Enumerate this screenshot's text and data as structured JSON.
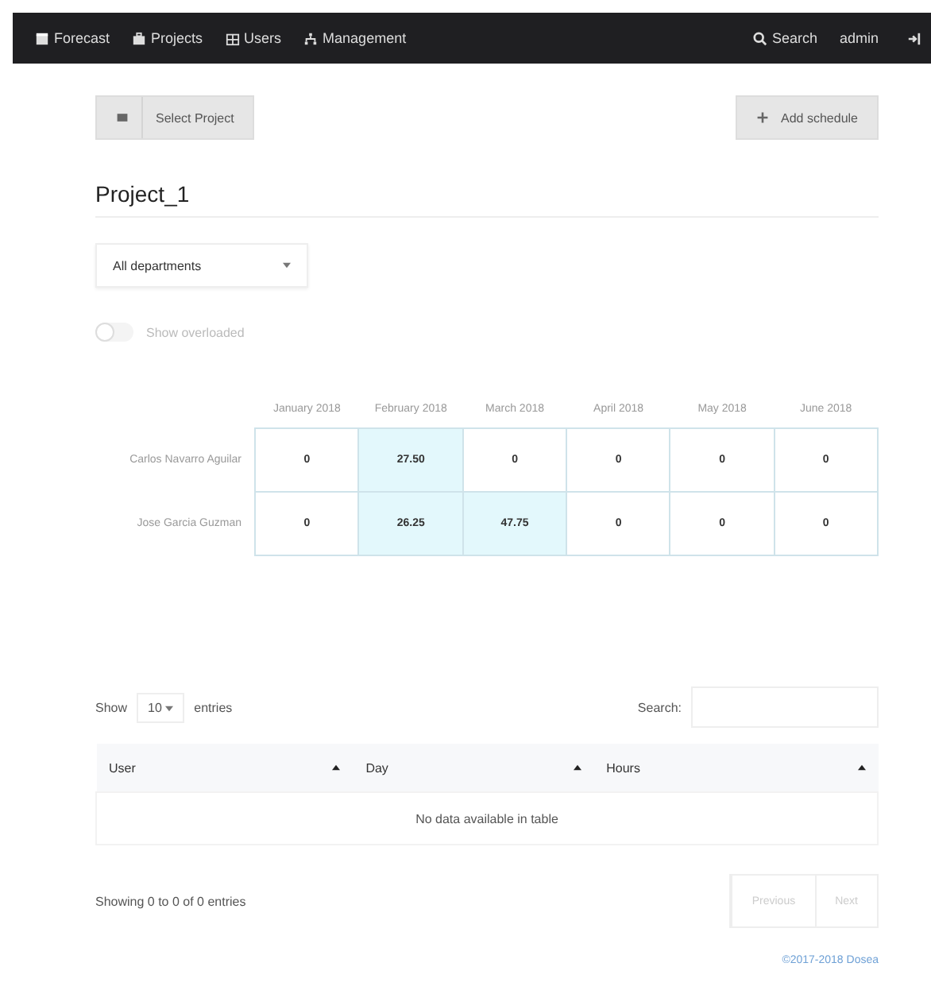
{
  "navbar": {
    "left": [
      {
        "label": "Forecast"
      },
      {
        "label": "Projects"
      },
      {
        "label": "Users"
      },
      {
        "label": "Management"
      }
    ],
    "search": "Search",
    "user": "admin"
  },
  "select_project": "Select Project",
  "add_schedule": "Add schedule",
  "project_title": "Project_1",
  "department": "All departments",
  "overloaded_toggle": {
    "label": "Show overloaded",
    "on": false
  },
  "grid": {
    "columns": [
      "January 2018",
      "February 2018",
      "March 2018",
      "April 2018",
      "May 2018",
      "June 2018"
    ],
    "rows": [
      {
        "name": "Carlos Navarro Aguilar",
        "cells": [
          {
            "value": "0",
            "highlight": false
          },
          {
            "value": "27.50",
            "highlight": true
          },
          {
            "value": "0",
            "highlight": false
          },
          {
            "value": "0",
            "highlight": false
          },
          {
            "value": "0",
            "highlight": false
          },
          {
            "value": "0",
            "highlight": false
          }
        ]
      },
      {
        "name": "Jose Garcia Guzman",
        "cells": [
          {
            "value": "0",
            "highlight": false
          },
          {
            "value": "26.25",
            "highlight": true
          },
          {
            "value": "47.75",
            "highlight": true
          },
          {
            "value": "0",
            "highlight": false
          },
          {
            "value": "0",
            "highlight": false
          },
          {
            "value": "0",
            "highlight": false
          }
        ]
      }
    ]
  },
  "entries": {
    "show": "Show",
    "count": "10",
    "suffix": "entries",
    "search_label": "Search:"
  },
  "table": {
    "columns": [
      "User",
      "Day",
      "Hours"
    ],
    "empty": "No data available in table"
  },
  "info": "Showing 0 to 0 of 0 entries",
  "pagination": [
    {
      "label": "Previous",
      "disabled": true
    },
    {
      "label": "Next",
      "disabled": true
    }
  ],
  "footer": "©2017-2018 Dosea"
}
